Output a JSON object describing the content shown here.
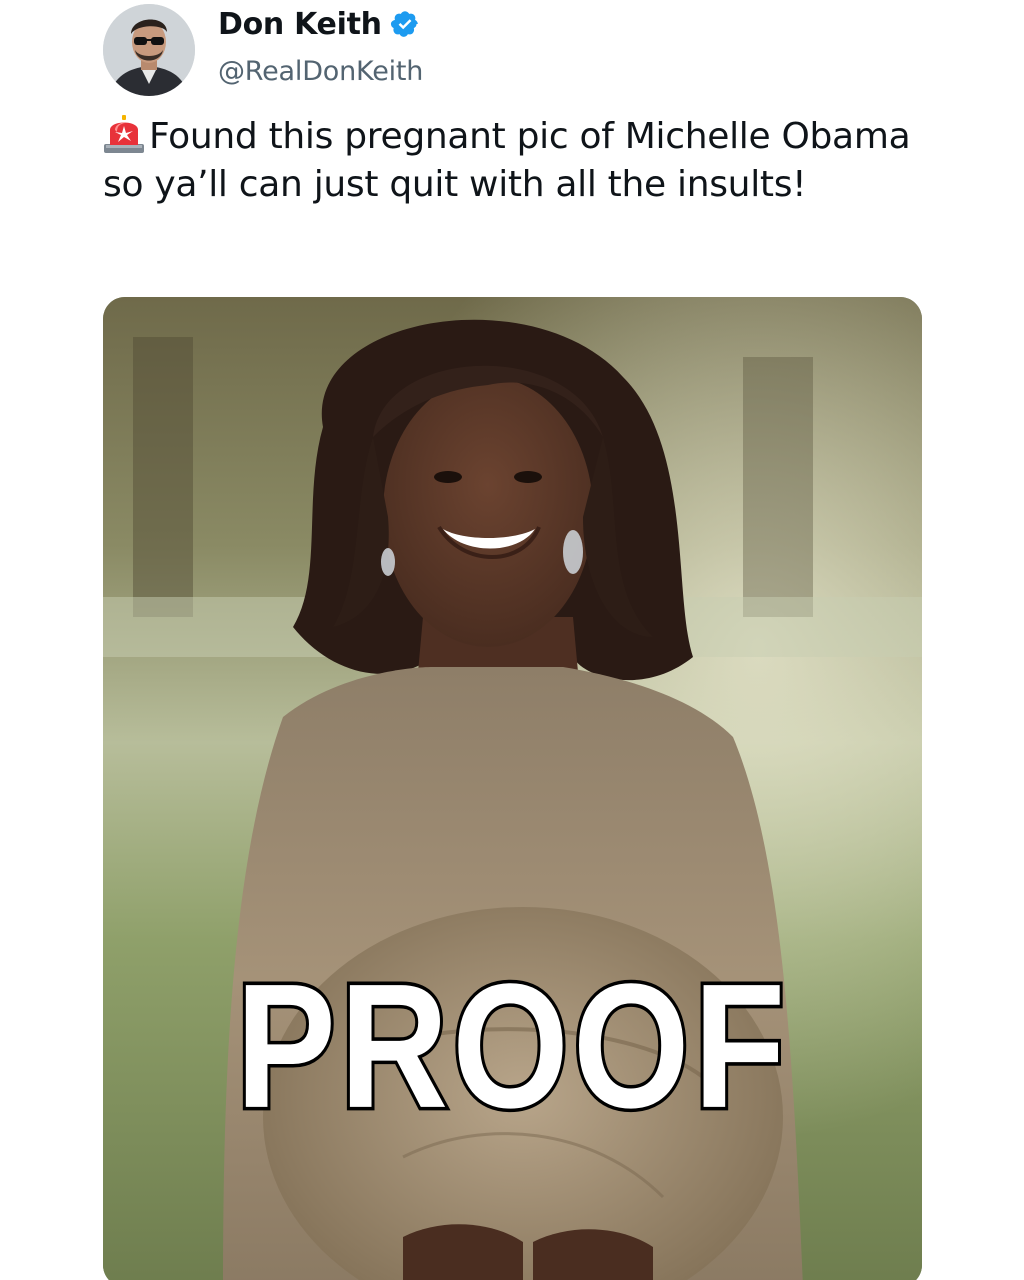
{
  "author": {
    "display_name": "Don Keith",
    "handle": "@RealDonKeith",
    "verified": true,
    "verified_color": "#1d9bf0"
  },
  "tweet": {
    "text": "Found this pregnant pic of Michelle Obama so ya’ll can just quit with all the insults!",
    "leading_icon": "police-siren-emoji"
  },
  "media": {
    "caption": "PROOF"
  }
}
